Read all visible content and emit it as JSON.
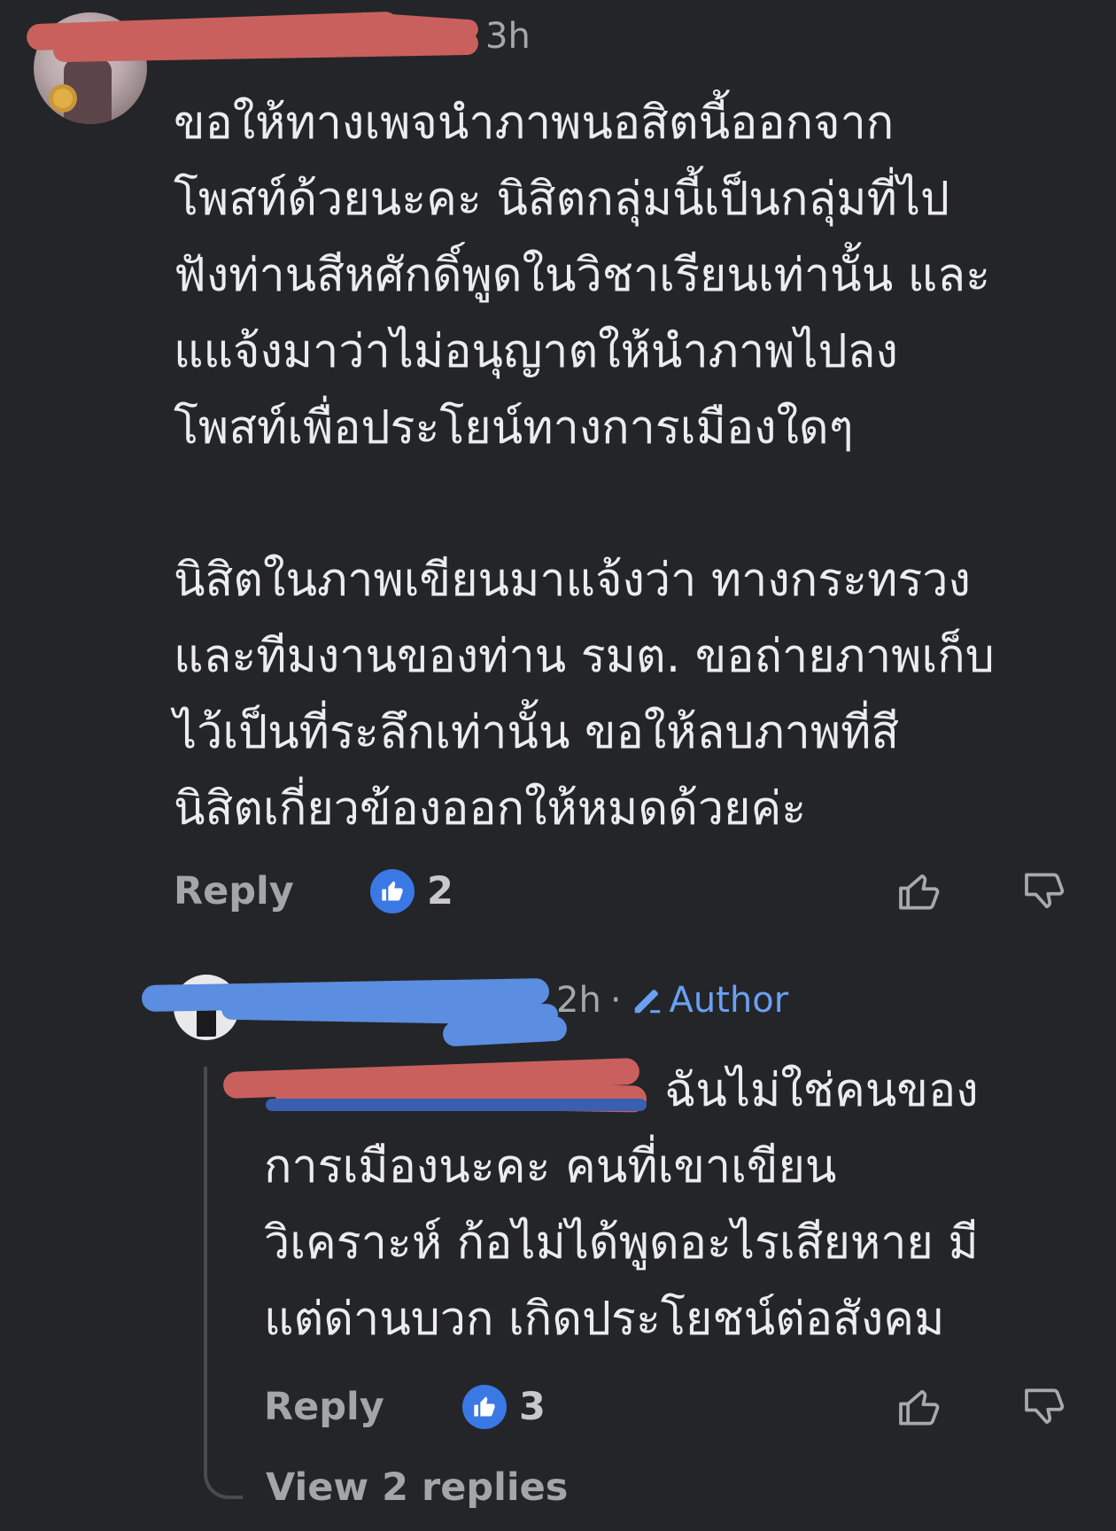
{
  "comment": {
    "time": "3h",
    "lines": [
      "ขอให้ทางเพจนำภาพนอสิตนี้ออกจาก",
      "โพสท์ด้วยนะคะ นิสิตกลุ่มนี้เป็นกลุ่มที่ไป",
      "ฟังท่านสีหศักดิ์พูดในวิชาเรียนเท่านั้น และ",
      "แแจ้งมาว่าไม่อนุญาตให้นำภาพไปลง",
      "โพสท์เพื่อประโยน์ทางการเมืองใดๆ",
      "",
      "นิสิตในภาพเขียนมาแจ้งว่า ทางกระทรวง",
      "และทีมงานของท่าน รมต. ขอถ่ายภาพเก็บ",
      "ไว้เป็นที่ระลึกเท่านั้น ขอให้ลบภาพที่สี",
      "นิสิตเกี่ยวข้องออกให้หมดด้วยค่ะ"
    ],
    "reply_label": "Reply",
    "reaction_count": "2"
  },
  "reply": {
    "time": "2h",
    "separator": "·",
    "author_label": "Author",
    "lines": [
      "ฉันไม่ใช่คนของ",
      "การเมืองนะคะ  คนที่เขาเขียน",
      "วิเคราะห์ ก้อไม่ได้พูดอะไรเสียหาย  มี",
      "แต่ด่านบวก เกิดประโยชน์ต่อสังคม"
    ],
    "reply_label": "Reply",
    "reaction_count": "3",
    "view_replies": "View 2 replies"
  },
  "icons": {
    "like_badge": "thumbs-up-icon",
    "upvote": "thumbs-up-outline-icon",
    "downvote": "thumbs-down-outline-icon",
    "author": "pencil-icon"
  },
  "colors": {
    "background": "#242528",
    "accent_blue": "#3a78e6",
    "author_blue": "#6aa0f2",
    "redaction_red": "#c9605e",
    "redaction_blue": "#5b8de0"
  }
}
